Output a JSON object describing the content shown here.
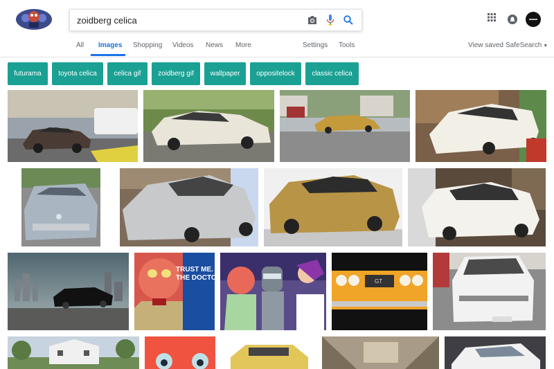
{
  "search": {
    "query": "zoidberg celica"
  },
  "tabs": [
    {
      "label": "All"
    },
    {
      "label": "Images"
    },
    {
      "label": "Shopping"
    },
    {
      "label": "Videos"
    },
    {
      "label": "News"
    },
    {
      "label": "More"
    },
    {
      "label": "Settings"
    },
    {
      "label": "Tools"
    }
  ],
  "right_links": {
    "view_saved": "View saved",
    "safesearch": "SafeSearch"
  },
  "chips": [
    "futurama",
    "toyota celica",
    "celica gif",
    "zoidberg gif",
    "wallpaper",
    "oppositelock",
    "classic celica"
  ],
  "colors": {
    "accent": "#1a73e8",
    "chip": "#1aa193"
  },
  "image_texts": {
    "trust": "TRUST ME.",
    "doctor": "THE DOCTO",
    "gt": "GT"
  }
}
